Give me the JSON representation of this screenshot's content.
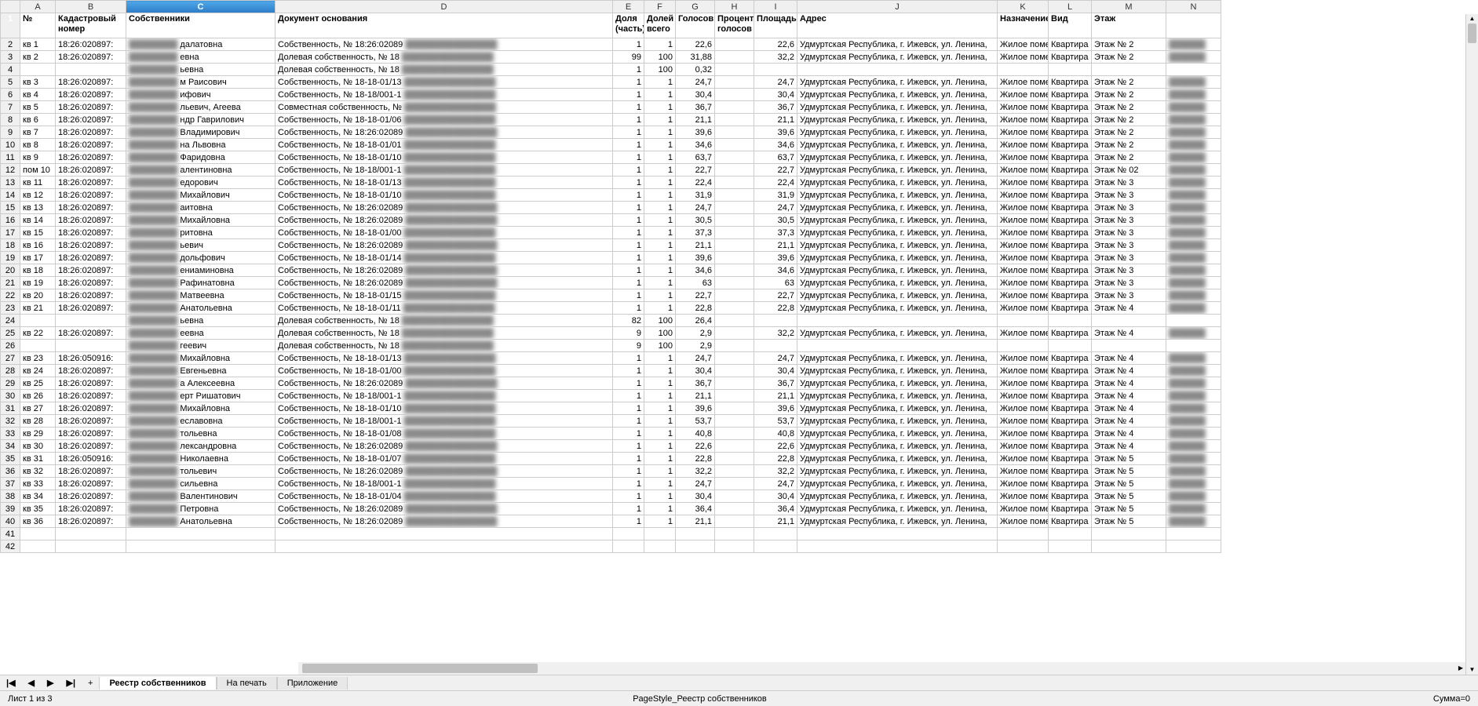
{
  "columns": [
    "A",
    "B",
    "C",
    "D",
    "E",
    "F",
    "G",
    "H",
    "I",
    "J",
    "K",
    "L",
    "M",
    "N"
  ],
  "headers": {
    "A": "№",
    "B": "Кадастровый номер",
    "C": "Собственники",
    "D": "Документ основания",
    "E": "Доля (часть)",
    "F": "Долей всего",
    "G": "Голосов",
    "H": "Процент голосов",
    "I": "Площадь",
    "J": "Адрес",
    "K": "Назначение",
    "L": "Вид",
    "M": "Этаж",
    "N": ""
  },
  "address_base": "Удмуртская Республика, г. Ижевск, ул. Ленина,",
  "purpose": "Жилое поме",
  "kind": "Квартира",
  "rows": [
    {
      "r": 2,
      "no": "кв 1",
      "kn": "18:26:020897:",
      "own": "далатовна",
      "doc": "Собственность, № 18:26:02089",
      "d1": "1",
      "d2": "1",
      "gv": "22,6",
      "pg": "",
      "sq": "22,6",
      "floor": "Этаж № 2"
    },
    {
      "r": 3,
      "no": "кв 2",
      "kn": "18:26:020897:",
      "own": "евна",
      "doc": "Долевая собственность, № 18",
      "d1": "99",
      "d2": "100",
      "gv": "31,88",
      "pg": "",
      "sq": "32,2",
      "addr": "Удмуртская Республика, г. Ижевск, ул. Ленина,",
      "floor": "Этаж № 2"
    },
    {
      "r": 4,
      "no": "",
      "kn": "",
      "own": "ьевна",
      "doc": "Долевая собственность, № 18",
      "d1": "1",
      "d2": "100",
      "gv": "0,32",
      "pg": "",
      "sq": "",
      "addr": "",
      "floor": ""
    },
    {
      "r": 5,
      "no": "кв 3",
      "kn": "18:26:020897:",
      "own": "м Раисович",
      "doc": "Собственность, № 18-18-01/13",
      "d1": "1",
      "d2": "1",
      "gv": "24,7",
      "pg": "",
      "sq": "24,7",
      "floor": "Этаж № 2"
    },
    {
      "r": 6,
      "no": "кв 4",
      "kn": "18:26:020897:",
      "own": "ифович",
      "doc": "Собственность, № 18-18/001-1",
      "d1": "1",
      "d2": "1",
      "gv": "30,4",
      "pg": "",
      "sq": "30,4",
      "floor": "Этаж № 2"
    },
    {
      "r": 7,
      "no": "кв 5",
      "kn": "18:26:020897:",
      "own": "льевич, Агеева",
      "doc": "Совместная собственность, №",
      "d1": "1",
      "d2": "1",
      "gv": "36,7",
      "pg": "",
      "sq": "36,7",
      "floor": "Этаж № 2"
    },
    {
      "r": 8,
      "no": "кв 6",
      "kn": "18:26:020897:",
      "own": "ндр Гаврилович",
      "doc": "Собственность, № 18-18-01/06",
      "d1": "1",
      "d2": "1",
      "gv": "21,1",
      "pg": "",
      "sq": "21,1",
      "floor": "Этаж № 2"
    },
    {
      "r": 9,
      "no": "кв 7",
      "kn": "18:26:020897:",
      "own": "Владимирович",
      "doc": "Собственность, № 18:26:02089",
      "d1": "1",
      "d2": "1",
      "gv": "39,6",
      "pg": "",
      "sq": "39,6",
      "floor": "Этаж № 2"
    },
    {
      "r": 10,
      "no": "кв 8",
      "kn": "18:26:020897:",
      "own": "на Львовна",
      "doc": "Собственность, № 18-18-01/01",
      "d1": "1",
      "d2": "1",
      "gv": "34,6",
      "pg": "",
      "sq": "34,6",
      "floor": "Этаж № 2"
    },
    {
      "r": 11,
      "no": "кв 9",
      "kn": "18:26:020897:",
      "own": "Фаридовна",
      "doc": "Собственность, № 18-18-01/10",
      "d1": "1",
      "d2": "1",
      "gv": "63,7",
      "pg": "",
      "sq": "63,7",
      "floor": "Этаж № 2"
    },
    {
      "r": 12,
      "no": "пом 10",
      "kn": "18:26:020897:",
      "own": "алентиновна",
      "doc": "Собственность, № 18-18/001-1",
      "d1": "1",
      "d2": "1",
      "gv": "22,7",
      "pg": "",
      "sq": "22,7",
      "floor": "Этаж № 02"
    },
    {
      "r": 13,
      "no": "кв 11",
      "kn": "18:26:020897:",
      "own": "едорович",
      "doc": "Собственность, № 18-18-01/13",
      "d1": "1",
      "d2": "1",
      "gv": "22,4",
      "pg": "",
      "sq": "22,4",
      "floor": "Этаж № 3"
    },
    {
      "r": 14,
      "no": "кв 12",
      "kn": "18:26:020897:",
      "own": "Михайлович",
      "doc": "Собственность, № 18-18-01/10",
      "d1": "1",
      "d2": "1",
      "gv": "31,9",
      "pg": "",
      "sq": "31,9",
      "floor": "Этаж № 3"
    },
    {
      "r": 15,
      "no": "кв 13",
      "kn": "18:26:020897:",
      "own": "аитовна",
      "doc": "Собственность, № 18:26:02089",
      "d1": "1",
      "d2": "1",
      "gv": "24,7",
      "pg": "",
      "sq": "24,7",
      "floor": "Этаж № 3"
    },
    {
      "r": 16,
      "no": "кв 14",
      "kn": "18:26:020897:",
      "own": "Михайловна",
      "doc": "Собственность, № 18:26:02089",
      "d1": "1",
      "d2": "1",
      "gv": "30,5",
      "pg": "",
      "sq": "30,5",
      "floor": "Этаж № 3"
    },
    {
      "r": 17,
      "no": "кв 15",
      "kn": "18:26:020897:",
      "own": "ритовна",
      "doc": "Собственность, № 18-18-01/00",
      "d1": "1",
      "d2": "1",
      "gv": "37,3",
      "pg": "",
      "sq": "37,3",
      "floor": "Этаж № 3"
    },
    {
      "r": 18,
      "no": "кв 16",
      "kn": "18:26:020897:",
      "own": "ьевич",
      "doc": "Собственность, № 18:26:02089",
      "d1": "1",
      "d2": "1",
      "gv": "21,1",
      "pg": "",
      "sq": "21,1",
      "floor": "Этаж № 3"
    },
    {
      "r": 19,
      "no": "кв 17",
      "kn": "18:26:020897:",
      "own": "дольфович",
      "doc": "Собственность, № 18-18-01/14",
      "d1": "1",
      "d2": "1",
      "gv": "39,6",
      "pg": "",
      "sq": "39,6",
      "floor": "Этаж № 3"
    },
    {
      "r": 20,
      "no": "кв 18",
      "kn": "18:26:020897:",
      "own": "ениаминовна",
      "doc": "Собственность, № 18:26:02089",
      "d1": "1",
      "d2": "1",
      "gv": "34,6",
      "pg": "",
      "sq": "34,6",
      "floor": "Этаж № 3"
    },
    {
      "r": 21,
      "no": "кв 19",
      "kn": "18:26:020897:",
      "own": "Рафинатовна",
      "doc": "Собственность, № 18:26:02089",
      "d1": "1",
      "d2": "1",
      "gv": "63",
      "pg": "",
      "sq": "63",
      "floor": "Этаж № 3"
    },
    {
      "r": 22,
      "no": "кв 20",
      "kn": "18:26:020897:",
      "own": "Матвеевна",
      "doc": "Собственность, № 18-18-01/15",
      "d1": "1",
      "d2": "1",
      "gv": "22,7",
      "pg": "",
      "sq": "22,7",
      "floor": "Этаж № 3"
    },
    {
      "r": 23,
      "no": "кв 21",
      "kn": "18:26:020897:",
      "own": "Анатольевна",
      "doc": "Собственность, № 18-18-01/11",
      "d1": "1",
      "d2": "1",
      "gv": "22,8",
      "pg": "",
      "sq": "22,8",
      "floor": "Этаж № 4"
    },
    {
      "r": 24,
      "no": "",
      "kn": "",
      "own": "ьевна",
      "doc": "Долевая собственность, № 18",
      "d1": "82",
      "d2": "100",
      "gv": "26,4",
      "pg": "",
      "sq": "",
      "addr": "",
      "floor": ""
    },
    {
      "r": 25,
      "no": "кв 22",
      "kn": "18:26:020897:",
      "own": "еевна",
      "doc": "Долевая собственность, № 18",
      "d1": "9",
      "d2": "100",
      "gv": "2,9",
      "pg": "",
      "sq": "32,2",
      "floor": "Этаж № 4"
    },
    {
      "r": 26,
      "no": "",
      "kn": "",
      "own": "геевич",
      "doc": "Долевая собственность, № 18",
      "d1": "9",
      "d2": "100",
      "gv": "2,9",
      "pg": "",
      "sq": "",
      "addr": "",
      "floor": ""
    },
    {
      "r": 27,
      "no": "кв 23",
      "kn": "18:26:050916:",
      "own": "Михайловна",
      "doc": "Собственность, № 18-18-01/13",
      "d1": "1",
      "d2": "1",
      "gv": "24,7",
      "pg": "",
      "sq": "24,7",
      "floor": "Этаж № 4"
    },
    {
      "r": 28,
      "no": "кв 24",
      "kn": "18:26:020897:",
      "own": "Евгеньевна",
      "doc": "Собственность, № 18-18-01/00",
      "d1": "1",
      "d2": "1",
      "gv": "30,4",
      "pg": "",
      "sq": "30,4",
      "floor": "Этаж № 4"
    },
    {
      "r": 29,
      "no": "кв 25",
      "kn": "18:26:020897:",
      "own": "а Алексеевна",
      "doc": "Собственность, № 18:26:02089",
      "d1": "1",
      "d2": "1",
      "gv": "36,7",
      "pg": "",
      "sq": "36,7",
      "floor": "Этаж № 4"
    },
    {
      "r": 30,
      "no": "кв 26",
      "kn": "18:26:020897:",
      "own": "ерт Ришатович",
      "doc": "Собственность, № 18-18/001-1",
      "d1": "1",
      "d2": "1",
      "gv": "21,1",
      "pg": "",
      "sq": "21,1",
      "floor": "Этаж № 4"
    },
    {
      "r": 31,
      "no": "кв 27",
      "kn": "18:26:020897:",
      "own": "Михайловна",
      "doc": "Собственность, № 18-18-01/10",
      "d1": "1",
      "d2": "1",
      "gv": "39,6",
      "pg": "",
      "sq": "39,6",
      "floor": "Этаж № 4"
    },
    {
      "r": 32,
      "no": "кв 28",
      "kn": "18:26:020897:",
      "own": "еславовна",
      "doc": "Собственность, № 18-18/001-1",
      "d1": "1",
      "d2": "1",
      "gv": "53,7",
      "pg": "",
      "sq": "53,7",
      "floor": "Этаж № 4"
    },
    {
      "r": 33,
      "no": "кв 29",
      "kn": "18:26:020897:",
      "own": "тольевна",
      "doc": "Собственность, № 18-18-01/08",
      "d1": "1",
      "d2": "1",
      "gv": "40,8",
      "pg": "",
      "sq": "40,8",
      "floor": "Этаж № 4"
    },
    {
      "r": 34,
      "no": "кв 30",
      "kn": "18:26:020897:",
      "own": "лександровна",
      "doc": "Собственность, № 18:26:02089",
      "d1": "1",
      "d2": "1",
      "gv": "22,6",
      "pg": "",
      "sq": "22,6",
      "floor": "Этаж № 4"
    },
    {
      "r": 35,
      "no": "кв 31",
      "kn": "18:26:050916:",
      "own": "Николаевна",
      "doc": "Собственность, № 18-18-01/07",
      "d1": "1",
      "d2": "1",
      "gv": "22,8",
      "pg": "",
      "sq": "22,8",
      "floor": "Этаж № 5"
    },
    {
      "r": 36,
      "no": "кв 32",
      "kn": "18:26:020897:",
      "own": "тольевич",
      "doc": "Собственность, № 18:26:02089",
      "d1": "1",
      "d2": "1",
      "gv": "32,2",
      "pg": "",
      "sq": "32,2",
      "floor": "Этаж № 5"
    },
    {
      "r": 37,
      "no": "кв 33",
      "kn": "18:26:020897:",
      "own": "сильевна",
      "doc": "Собственность, № 18-18/001-1",
      "d1": "1",
      "d2": "1",
      "gv": "24,7",
      "pg": "",
      "sq": "24,7",
      "floor": "Этаж № 5"
    },
    {
      "r": 38,
      "no": "кв 34",
      "kn": "18:26:020897:",
      "own": "Валентинович",
      "doc": "Собственность, № 18-18-01/04",
      "d1": "1",
      "d2": "1",
      "gv": "30,4",
      "pg": "",
      "sq": "30,4",
      "floor": "Этаж № 5"
    },
    {
      "r": 39,
      "no": "кв 35",
      "kn": "18:26:020897:",
      "own": "Петровна",
      "doc": "Собственность, № 18:26:02089",
      "d1": "1",
      "d2": "1",
      "gv": "36,4",
      "pg": "",
      "sq": "36,4",
      "floor": "Этаж № 5"
    },
    {
      "r": 40,
      "no": "кв 36",
      "kn": "18:26:020897:",
      "own": "Анатольевна",
      "doc": "Собственность, № 18:26:02089",
      "d1": "1",
      "d2": "1",
      "gv": "21,1",
      "pg": "",
      "sq": "21,1",
      "floor": "Этаж № 5"
    },
    {
      "r": 41,
      "no": "",
      "kn": "",
      "own": "",
      "doc": "",
      "d1": "",
      "d2": "",
      "gv": "",
      "pg": "",
      "sq": "",
      "addr": "",
      "floor": "",
      "empty": true
    },
    {
      "r": 42,
      "no": "",
      "kn": "",
      "own": "",
      "doc": "",
      "d1": "",
      "d2": "",
      "gv": "",
      "pg": "",
      "sq": "",
      "addr": "",
      "floor": "",
      "empty": true
    }
  ],
  "tabs": {
    "nav_first": "|◀",
    "nav_prev": "◀",
    "nav_next": "▶",
    "nav_last": "▶|",
    "add": "+",
    "items": [
      "Реестр собственников",
      "На печать",
      "Приложение"
    ]
  },
  "status": {
    "left": "Лист 1 из 3",
    "center": "PageStyle_Реестр собственников",
    "right": "Сумма=0"
  }
}
